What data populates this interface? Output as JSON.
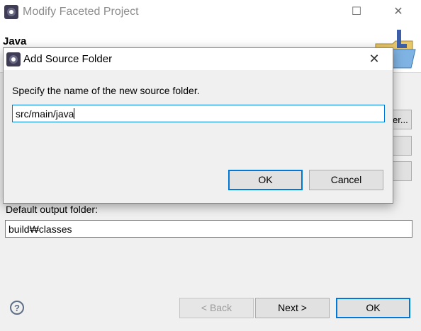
{
  "window": {
    "title": "Modify Faceted Project",
    "page_title": "Java",
    "side_button_partial": "er...",
    "default_output_label": "Default output folder:",
    "default_output_value": "build₩classes",
    "buttons": {
      "back": "< Back",
      "next": "Next >",
      "ok": "OK"
    },
    "help_icon": "question-icon",
    "minimize_glyph": "☐",
    "close_glyph": "✕"
  },
  "dialog": {
    "title": "Add Source Folder",
    "prompt": "Specify the name of the new source folder.",
    "folder_name": "src/main/java",
    "ok": "OK",
    "cancel": "Cancel",
    "close_glyph": "✕"
  },
  "colors": {
    "focus_accent": "#0078d7",
    "icon_dark": "#3f3d56"
  }
}
